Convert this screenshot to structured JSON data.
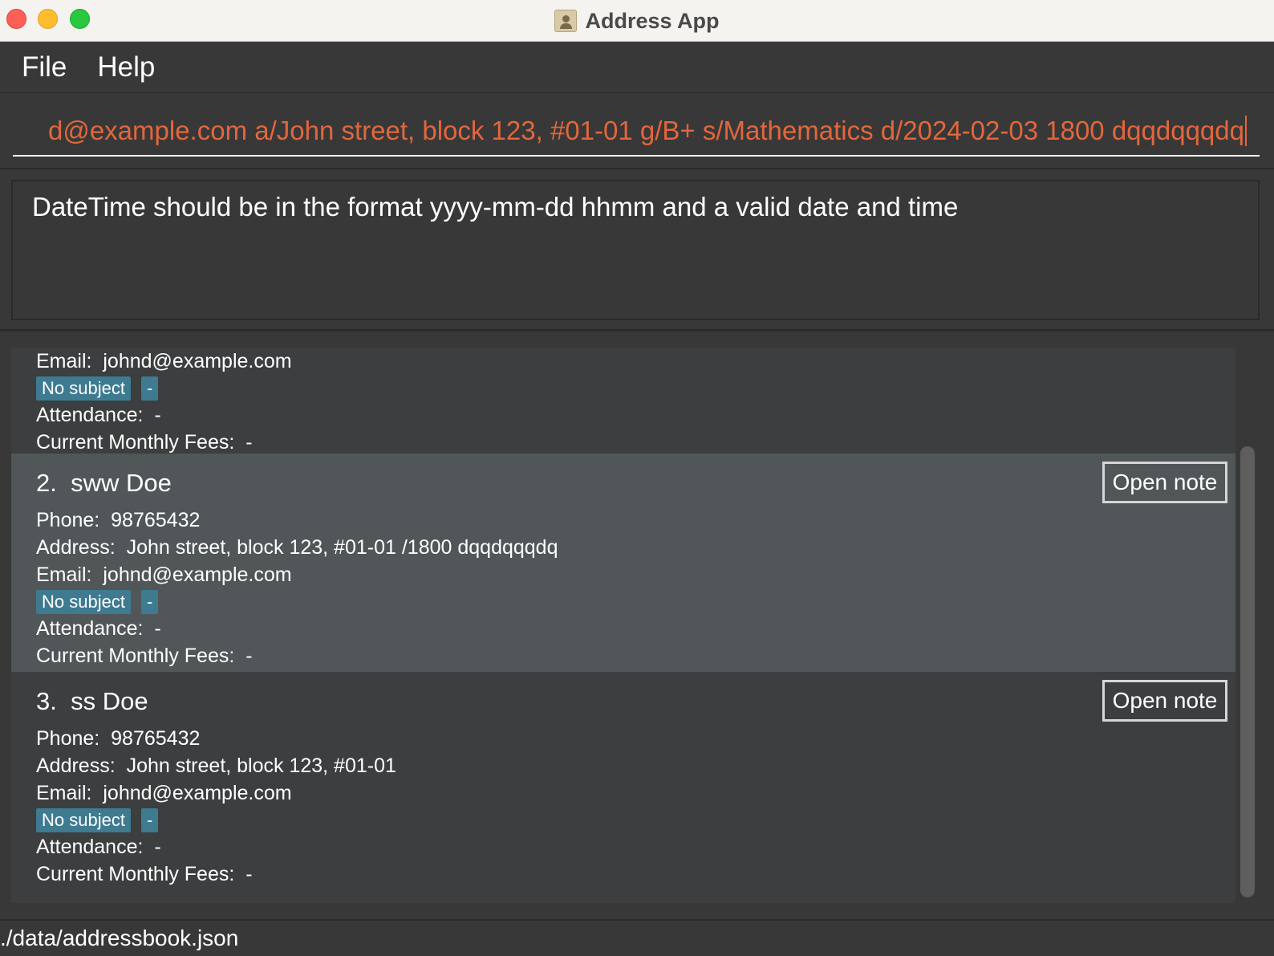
{
  "window": {
    "title": "Address App",
    "icon": "address-book-icon"
  },
  "menu": {
    "items": [
      "File",
      "Help"
    ]
  },
  "command": {
    "value": "d@example.com a/John street, block 123, #01-01 g/B+ s/Mathematics d/2024-02-03 1800 dqqdqqqdq"
  },
  "result": {
    "message": "DateTime should be in the format yyyy-mm-dd hhmm and a valid date and time"
  },
  "persons": [
    {
      "email_label": "Email:",
      "email": "johnd@example.com",
      "tags": [
        "No subject",
        "-"
      ],
      "attendance_label": "Attendance:",
      "attendance": "-",
      "fees_label": "Current Monthly Fees:",
      "fees": "-"
    },
    {
      "index": "2.",
      "name": "sww Doe",
      "phone_label": "Phone:",
      "phone": "98765432",
      "address_label": "Address:",
      "address": "John street, block 123, #01-01  /1800 dqqdqqqdq",
      "email_label": "Email:",
      "email": "johnd@example.com",
      "tags": [
        "No subject",
        "-"
      ],
      "attendance_label": "Attendance:",
      "attendance": "-",
      "fees_label": "Current Monthly Fees:",
      "fees": "-",
      "note_button": "Open note"
    },
    {
      "index": "3.",
      "name": "ss Doe",
      "phone_label": "Phone:",
      "phone": "98765432",
      "address_label": "Address:",
      "address": "John street, block 123, #01-01",
      "email_label": "Email:",
      "email": "johnd@example.com",
      "tags": [
        "No subject",
        "-"
      ],
      "attendance_label": "Attendance:",
      "attendance": "-",
      "fees_label": "Current Monthly Fees:",
      "fees": "-",
      "note_button": "Open note"
    }
  ],
  "status": {
    "path": "./data/addressbook.json"
  },
  "colors": {
    "background": "#383838",
    "command_text": "#e2673c",
    "tag": "#3e7b91",
    "selected_card": "#515658",
    "card": "#3c3e3f"
  }
}
